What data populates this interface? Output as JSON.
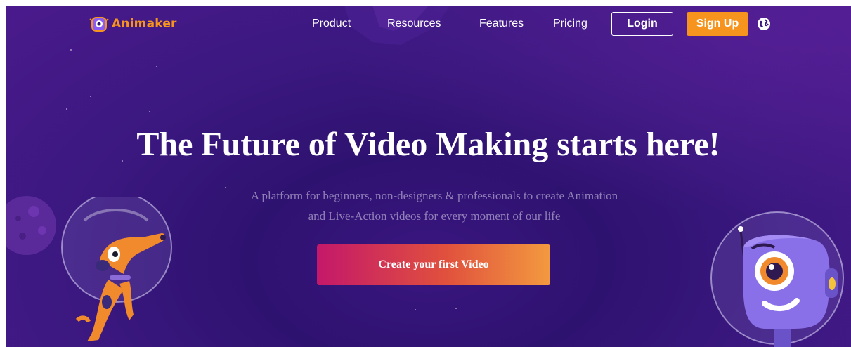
{
  "brand": {
    "logo_text": "Animaker"
  },
  "nav": {
    "links": [
      "Product",
      "Resources",
      "Features",
      "Pricing"
    ],
    "login_label": "Login",
    "signup_label": "Sign Up",
    "language_icon": "globe-icon"
  },
  "hero": {
    "title": "The Future of Video Making starts here!",
    "subtitle_line1": "A platform for beginners, non-designers & professionals to create Animation",
    "subtitle_line2": "and Live-Action videos for every moment of our life",
    "cta_label": "Create your first Video"
  },
  "colors": {
    "background": "#3a1680",
    "accent_orange": "#f7941d",
    "cta_gradient_start": "#c4186a",
    "cta_gradient_end": "#f39a3f"
  }
}
